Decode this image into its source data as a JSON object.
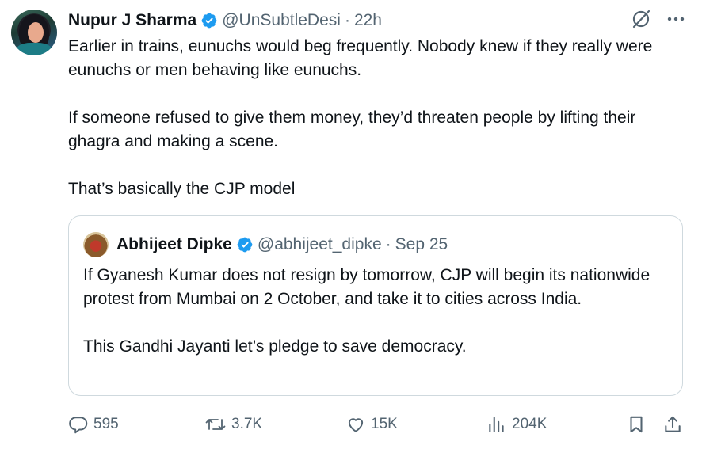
{
  "post": {
    "author_name": "Nupur J Sharma",
    "author_handle": "@UnSubtleDesi",
    "separator": "·",
    "time": "22h",
    "paragraphs": [
      "Earlier in trains, eunuchs would beg frequently. Nobody knew if they really were eunuchs or men behaving like eunuchs.",
      "If someone refused to give them money, they’d threaten people by lifting their ghagra and making a scene.",
      "That’s basically the CJP model"
    ]
  },
  "quote": {
    "author_name": "Abhijeet Dipke",
    "author_handle": "@abhijeet_dipke",
    "separator": "·",
    "date": "Sep 25",
    "paragraphs": [
      "If Gyanesh Kumar does not resign by tomorrow, CJP will begin its nationwide protest from Mumbai on 2 October, and take it to cities across India.",
      "This Gandhi Jayanti let’s pledge to save democracy."
    ]
  },
  "actions": {
    "replies": "595",
    "reposts": "3.7K",
    "likes": "15K",
    "views": "204K"
  },
  "icons": {
    "verified": "verified-badge-icon",
    "grok": "grok-icon",
    "more": "more-icon",
    "reply": "reply-icon",
    "repost": "repost-icon",
    "like": "like-icon",
    "views": "views-icon",
    "bookmark": "bookmark-icon",
    "share": "share-icon"
  },
  "colors": {
    "text": "#0f1419",
    "secondary": "#536471",
    "verified": "#1d9bf0",
    "border": "#cfd9de"
  }
}
